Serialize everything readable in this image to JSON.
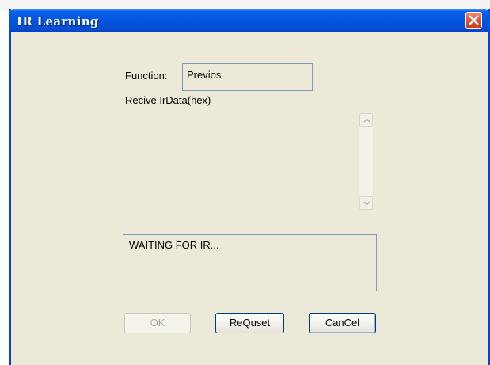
{
  "window": {
    "title": "IR Learning"
  },
  "function": {
    "label": "Function:",
    "value": "Previos"
  },
  "received": {
    "label": "Recive IrData(hex)",
    "value": ""
  },
  "status": {
    "text": "WAITING FOR IR..."
  },
  "buttons": {
    "ok": "OK",
    "request": "ReQuset",
    "cancel": "CanCel"
  },
  "icons": {
    "close": "close-x-icon",
    "scroll_up": "chevron-up-icon",
    "scroll_down": "chevron-down-icon"
  },
  "colors": {
    "titlebar": "#0458e2",
    "window_bg": "#ece9d8",
    "close_button": "#e05a3c",
    "field_border": "#7f9db9"
  }
}
